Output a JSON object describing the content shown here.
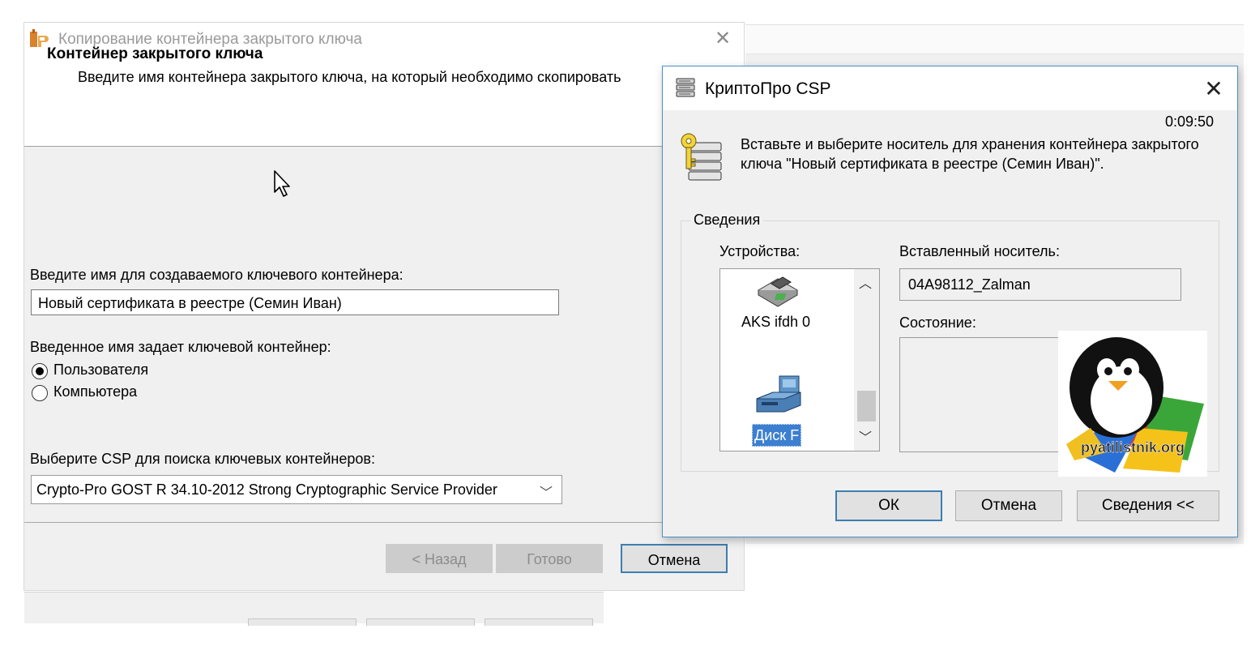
{
  "wizard": {
    "title": "Копирование контейнера закрытого ключа",
    "header_title": "Контейнер закрытого ключа",
    "header_subtitle": "Введите имя контейнера закрытого ключа, на который необходимо скопировать",
    "name_label": "Введите имя для создаваемого ключевого контейнера:",
    "name_value": "Новый сертификата в реестре (Семин Иван)",
    "scope_label": "Введенное имя задает ключевой контейнер:",
    "radio_user": "Пользователя",
    "radio_computer": "Компьютера",
    "csp_label": "Выберите CSP для поиска ключевых контейнеров:",
    "csp_value": "Crypto-Pro GOST R 34.10-2012 Strong Cryptographic Service Provider",
    "btn_back": "< Назад",
    "btn_finish": "Готово",
    "btn_cancel": "Отмена"
  },
  "crypto": {
    "title": "КриптоПро CSP",
    "timer": "0:09:50",
    "message": "Вставьте и выберите носитель для хранения контейнера закрытого ключа \"Новый сертификата в реестре (Семин Иван)\".",
    "details_legend": "Сведения",
    "devices_label": "Устройства:",
    "device_1": "AKS ifdh 0",
    "device_2": "Диск F",
    "inserted_label": "Вставленный носитель:",
    "inserted_value": "04A98112_Zalman",
    "state_label": "Состояние:",
    "btn_ok": "ОК",
    "btn_cancel": "Отмена",
    "btn_details": "Сведения <<",
    "logo_text": "pyatilistnik.org"
  }
}
